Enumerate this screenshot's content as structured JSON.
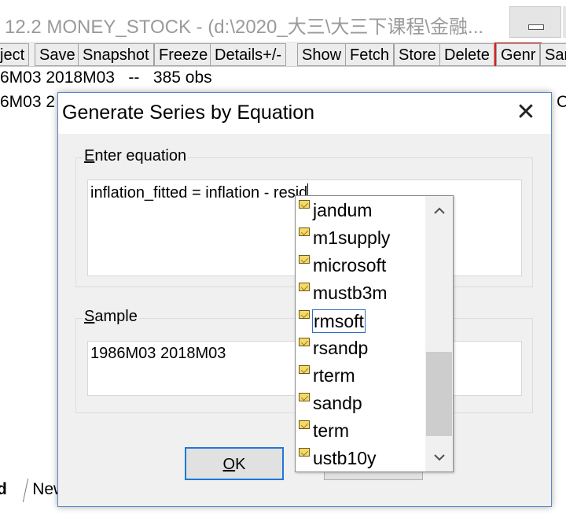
{
  "window": {
    "title": "12.2 MONEY_STOCK - (d:\\2020_大三\\大三下课程\\金融..."
  },
  "toolbar": {
    "buttons": [
      "ject",
      "Save",
      "Snapshot",
      "Freeze",
      "Details+/-",
      "Show",
      "Fetch",
      "Store",
      "Delete",
      "Genr",
      "Sar"
    ],
    "highlighted": "Genr"
  },
  "workfile": {
    "range_line": "6M03 2018M03   --   385 obs",
    "sample_line": "6M03 2",
    "edge_letter": "C"
  },
  "tabs": {
    "active": "d",
    "new": "New"
  },
  "dialog": {
    "title": "Generate Series by Equation",
    "close_glyph": "✕",
    "equation_group": {
      "label_accel": "E",
      "label_rest": "nter equation",
      "value": "inflation_fitted = inflation - resid"
    },
    "sample_group": {
      "label_accel": "S",
      "label_rest": "ample",
      "value": "1986M03 2018M03"
    },
    "ok_button": {
      "accel": "O",
      "rest": "K"
    }
  },
  "autocomplete": {
    "items": [
      "jandum",
      "m1supply",
      "microsoft",
      "mustb3m",
      "rmsoft",
      "rsandp",
      "rterm",
      "sandp",
      "term",
      "ustb10y"
    ],
    "focused": "rmsoft",
    "icon": "series-icon",
    "scroll_up": "^",
    "scroll_down": "v"
  },
  "colors": {
    "highlight_border": "#e02020",
    "default_button_border": "#1e78d7",
    "series_icon": "#f6d866"
  }
}
